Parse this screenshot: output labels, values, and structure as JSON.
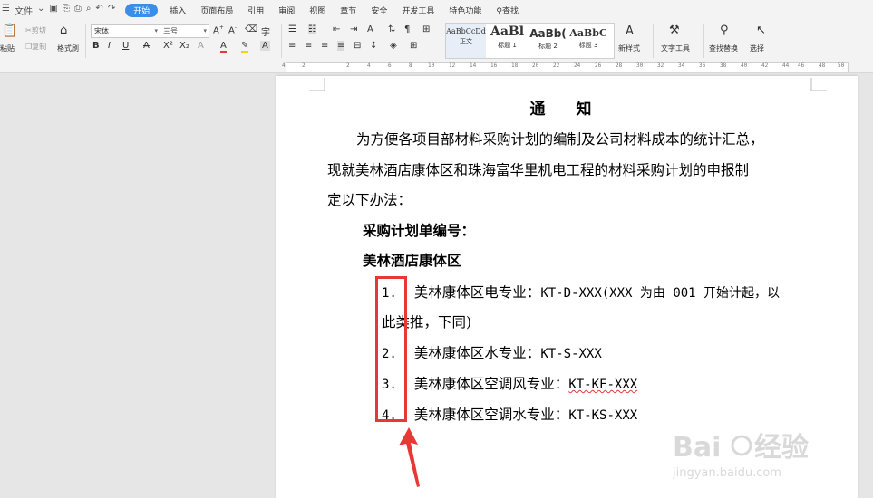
{
  "menubar": {
    "file_label": "文件",
    "tabs": [
      "开始",
      "插入",
      "页面布局",
      "引用",
      "审阅",
      "视图",
      "章节",
      "安全",
      "开发工具",
      "特色功能"
    ],
    "active_tab": "开始",
    "search_label": "查找"
  },
  "ribbon": {
    "paste_label": "粘贴",
    "cut_label": "剪切",
    "copy_label": "复制",
    "format_painter_label": "格式刷",
    "font_name": "宋体",
    "font_size": "三号",
    "styles": [
      {
        "sample": "AaBbCcDd",
        "label": "正文"
      },
      {
        "sample": "AaBl",
        "label": "标题 1"
      },
      {
        "sample": "AaBb(",
        "label": "标题 2"
      },
      {
        "sample": "AaBbC",
        "label": "标题 3"
      }
    ],
    "new_style_label": "新样式",
    "text_tools_label": "文字工具",
    "find_replace_label": "查找替换",
    "select_label": "选择"
  },
  "ruler": {
    "ticks": [
      "4",
      "2",
      "2",
      "4",
      "6",
      "8",
      "10",
      "12",
      "14",
      "16",
      "18",
      "20",
      "22",
      "24",
      "26",
      "28",
      "30",
      "32",
      "34",
      "36",
      "38",
      "40",
      "42",
      "44",
      "46",
      "48",
      "50"
    ]
  },
  "document": {
    "title": "通 知",
    "intro_line1": "为方便各项目部材料采购计划的编制及公司材料成本的统计汇总，",
    "intro_line2": "现就美林酒店康体区和珠海富华里机电工程的材料采购计划的申报制",
    "intro_line3": "定以下办法：",
    "heading1": "采购计划单编号：",
    "heading2": "美林酒店康体区",
    "items": [
      {
        "num": "1.",
        "text": "美林康体区电专业：",
        "code": "KT-D-XXX(XXX 为由 001 开始计起，以"
      },
      {
        "num": "2.",
        "text": "美林康体区水专业：",
        "code": "KT-S-XXX"
      },
      {
        "num": "3.",
        "text": "美林康体区空调风专业：",
        "code": "KT-KF-XXX"
      },
      {
        "num": "4.",
        "text": "美林康体区空调水专业：",
        "code": "KT-KS-XXX"
      }
    ],
    "item1_cont": "此类推，下同)"
  },
  "colors": {
    "accent": "#3a8ee6",
    "annotation_red": "#e53935"
  }
}
